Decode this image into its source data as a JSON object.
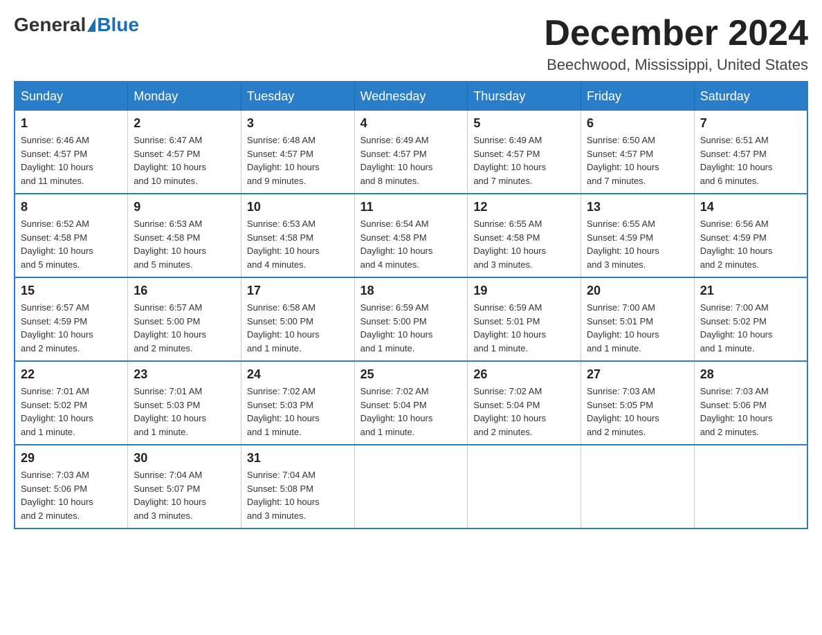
{
  "header": {
    "logo": {
      "text_before": "General",
      "text_after": "Blue"
    },
    "title": "December 2024",
    "location": "Beechwood, Mississippi, United States"
  },
  "calendar": {
    "days_of_week": [
      "Sunday",
      "Monday",
      "Tuesday",
      "Wednesday",
      "Thursday",
      "Friday",
      "Saturday"
    ],
    "weeks": [
      [
        {
          "day": "1",
          "sunrise": "6:46 AM",
          "sunset": "4:57 PM",
          "daylight": "10 hours and 11 minutes."
        },
        {
          "day": "2",
          "sunrise": "6:47 AM",
          "sunset": "4:57 PM",
          "daylight": "10 hours and 10 minutes."
        },
        {
          "day": "3",
          "sunrise": "6:48 AM",
          "sunset": "4:57 PM",
          "daylight": "10 hours and 9 minutes."
        },
        {
          "day": "4",
          "sunrise": "6:49 AM",
          "sunset": "4:57 PM",
          "daylight": "10 hours and 8 minutes."
        },
        {
          "day": "5",
          "sunrise": "6:49 AM",
          "sunset": "4:57 PM",
          "daylight": "10 hours and 7 minutes."
        },
        {
          "day": "6",
          "sunrise": "6:50 AM",
          "sunset": "4:57 PM",
          "daylight": "10 hours and 7 minutes."
        },
        {
          "day": "7",
          "sunrise": "6:51 AM",
          "sunset": "4:57 PM",
          "daylight": "10 hours and 6 minutes."
        }
      ],
      [
        {
          "day": "8",
          "sunrise": "6:52 AM",
          "sunset": "4:58 PM",
          "daylight": "10 hours and 5 minutes."
        },
        {
          "day": "9",
          "sunrise": "6:53 AM",
          "sunset": "4:58 PM",
          "daylight": "10 hours and 5 minutes."
        },
        {
          "day": "10",
          "sunrise": "6:53 AM",
          "sunset": "4:58 PM",
          "daylight": "10 hours and 4 minutes."
        },
        {
          "day": "11",
          "sunrise": "6:54 AM",
          "sunset": "4:58 PM",
          "daylight": "10 hours and 4 minutes."
        },
        {
          "day": "12",
          "sunrise": "6:55 AM",
          "sunset": "4:58 PM",
          "daylight": "10 hours and 3 minutes."
        },
        {
          "day": "13",
          "sunrise": "6:55 AM",
          "sunset": "4:59 PM",
          "daylight": "10 hours and 3 minutes."
        },
        {
          "day": "14",
          "sunrise": "6:56 AM",
          "sunset": "4:59 PM",
          "daylight": "10 hours and 2 minutes."
        }
      ],
      [
        {
          "day": "15",
          "sunrise": "6:57 AM",
          "sunset": "4:59 PM",
          "daylight": "10 hours and 2 minutes."
        },
        {
          "day": "16",
          "sunrise": "6:57 AM",
          "sunset": "5:00 PM",
          "daylight": "10 hours and 2 minutes."
        },
        {
          "day": "17",
          "sunrise": "6:58 AM",
          "sunset": "5:00 PM",
          "daylight": "10 hours and 1 minute."
        },
        {
          "day": "18",
          "sunrise": "6:59 AM",
          "sunset": "5:00 PM",
          "daylight": "10 hours and 1 minute."
        },
        {
          "day": "19",
          "sunrise": "6:59 AM",
          "sunset": "5:01 PM",
          "daylight": "10 hours and 1 minute."
        },
        {
          "day": "20",
          "sunrise": "7:00 AM",
          "sunset": "5:01 PM",
          "daylight": "10 hours and 1 minute."
        },
        {
          "day": "21",
          "sunrise": "7:00 AM",
          "sunset": "5:02 PM",
          "daylight": "10 hours and 1 minute."
        }
      ],
      [
        {
          "day": "22",
          "sunrise": "7:01 AM",
          "sunset": "5:02 PM",
          "daylight": "10 hours and 1 minute."
        },
        {
          "day": "23",
          "sunrise": "7:01 AM",
          "sunset": "5:03 PM",
          "daylight": "10 hours and 1 minute."
        },
        {
          "day": "24",
          "sunrise": "7:02 AM",
          "sunset": "5:03 PM",
          "daylight": "10 hours and 1 minute."
        },
        {
          "day": "25",
          "sunrise": "7:02 AM",
          "sunset": "5:04 PM",
          "daylight": "10 hours and 1 minute."
        },
        {
          "day": "26",
          "sunrise": "7:02 AM",
          "sunset": "5:04 PM",
          "daylight": "10 hours and 2 minutes."
        },
        {
          "day": "27",
          "sunrise": "7:03 AM",
          "sunset": "5:05 PM",
          "daylight": "10 hours and 2 minutes."
        },
        {
          "day": "28",
          "sunrise": "7:03 AM",
          "sunset": "5:06 PM",
          "daylight": "10 hours and 2 minutes."
        }
      ],
      [
        {
          "day": "29",
          "sunrise": "7:03 AM",
          "sunset": "5:06 PM",
          "daylight": "10 hours and 2 minutes."
        },
        {
          "day": "30",
          "sunrise": "7:04 AM",
          "sunset": "5:07 PM",
          "daylight": "10 hours and 3 minutes."
        },
        {
          "day": "31",
          "sunrise": "7:04 AM",
          "sunset": "5:08 PM",
          "daylight": "10 hours and 3 minutes."
        },
        null,
        null,
        null,
        null
      ]
    ],
    "sunrise_label": "Sunrise:",
    "sunset_label": "Sunset:",
    "daylight_label": "Daylight:"
  }
}
